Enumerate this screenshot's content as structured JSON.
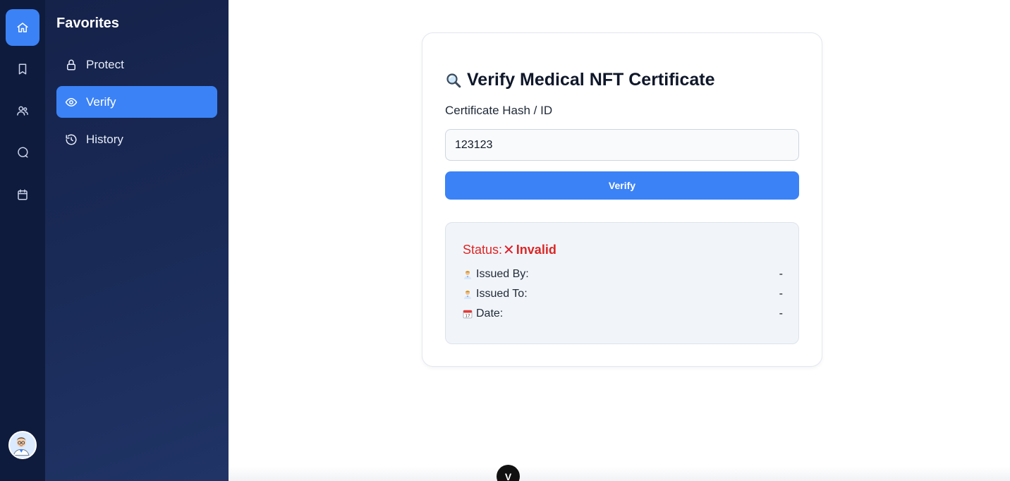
{
  "rail": {
    "items": [
      {
        "name": "home",
        "icon": "home-icon",
        "active": true
      },
      {
        "name": "bookmarks",
        "icon": "bookmark-icon",
        "active": false
      },
      {
        "name": "users",
        "icon": "users-icon",
        "active": false
      },
      {
        "name": "messages",
        "icon": "chat-icon",
        "active": false
      },
      {
        "name": "calendar",
        "icon": "calendar-icon",
        "active": false
      }
    ],
    "avatar_icon": "doctor-avatar-icon"
  },
  "sidebar": {
    "title": "Favorites",
    "items": [
      {
        "label": "Protect",
        "icon": "lock-icon",
        "active": false
      },
      {
        "label": "Verify",
        "icon": "eye-icon",
        "active": true
      },
      {
        "label": "History",
        "icon": "history-icon",
        "active": false
      }
    ]
  },
  "main": {
    "title": "Verify Medical NFT Certificate",
    "title_icon": "magnifier-icon",
    "hash_label": "Certificate Hash / ID",
    "hash_value": "123123",
    "verify_button": "Verify",
    "result": {
      "status_label": "Status:",
      "status_value": "Invalid",
      "status_icon": "cross-mark-icon",
      "rows": [
        {
          "label": "Issued By:",
          "value": "-",
          "icon": "doctor-icon"
        },
        {
          "label": "Issued To:",
          "value": "-",
          "icon": "doctor-icon"
        },
        {
          "label": "Date:",
          "value": "-",
          "icon": "calendar-emoji-icon"
        }
      ]
    }
  },
  "bottom": {
    "fab_label": "V",
    "fab_icon": "v-logo-icon"
  },
  "colors": {
    "accent": "#3b82f6",
    "rail_bg": "#0f1b3d",
    "invalid": "#dc2626"
  }
}
